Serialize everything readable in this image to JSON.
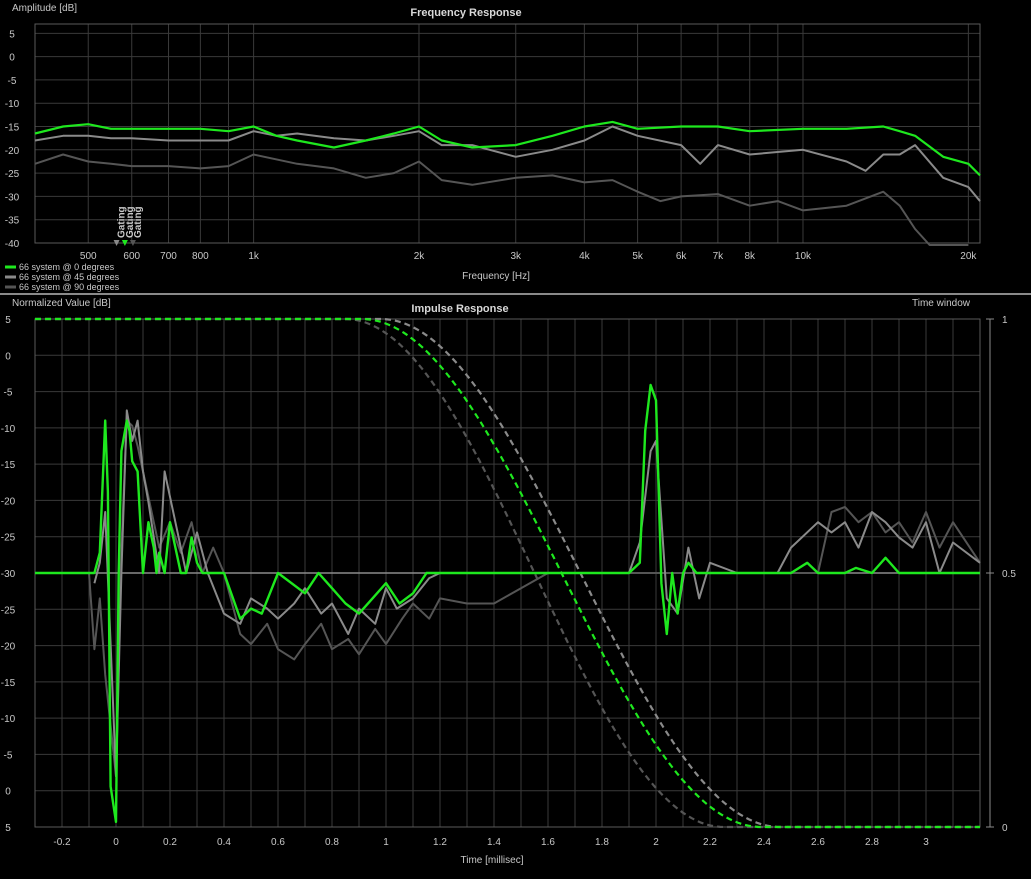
{
  "colors": {
    "green": "#1ee81e",
    "gray1": "#8a8a8a",
    "gray2": "#555555",
    "grid": "#3a3a3a",
    "separator": "#8a8a8a"
  },
  "chart_data": [
    {
      "type": "line",
      "title": "Frequency Response",
      "ylabel": "Amplitude [dB]",
      "xlabel": "Frequency [Hz]",
      "x_scale": "log",
      "xlim": [
        400,
        21000
      ],
      "ylim": [
        -40,
        7
      ],
      "grid": true,
      "y_ticks": [
        5,
        0,
        -5,
        -10,
        -15,
        -20,
        -25,
        -30,
        -35,
        -40
      ],
      "y_tick_labels": [
        "5",
        "0",
        "-5",
        "-10",
        "-15",
        "-20",
        "-25",
        "-30",
        "-35",
        "-40"
      ],
      "x_ticks": [
        500,
        600,
        700,
        800,
        1000,
        2000,
        3000,
        4000,
        5000,
        6000,
        7000,
        8000,
        10000,
        20000
      ],
      "x_tick_labels": [
        "500",
        "600",
        "700",
        "800",
        "1k",
        "2k",
        "3k",
        "4k",
        "5k",
        "6k",
        "7k",
        "8k",
        "10k",
        "20k"
      ],
      "gating_markers": [
        {
          "label": "Gating",
          "x": 563,
          "color": "#8a8a8a"
        },
        {
          "label": "Gating",
          "x": 583,
          "color": "#1ee81e"
        },
        {
          "label": "Gating",
          "x": 603,
          "color": "#555555"
        }
      ],
      "legend_position": "bottom-left",
      "series": [
        {
          "name": "66 system @ 0 degrees",
          "color": "#1ee81e",
          "x": [
            400,
            450,
            500,
            550,
            600,
            700,
            800,
            900,
            1000,
            1100,
            1200,
            1400,
            1600,
            1800,
            2000,
            2200,
            2500,
            3000,
            3500,
            4000,
            4500,
            5000,
            6000,
            7000,
            8000,
            10000,
            12000,
            14000,
            15000,
            16000,
            18000,
            20000,
            21000
          ],
          "y": [
            -16.5,
            -15,
            -14.5,
            -15.5,
            -15.5,
            -15.5,
            -15.5,
            -16,
            -15,
            -17,
            -18,
            -19.5,
            -18,
            -16.5,
            -15,
            -18,
            -19.5,
            -19,
            -17,
            -15,
            -14,
            -15.5,
            -15,
            -15,
            -16,
            -15.5,
            -15.5,
            -15,
            -16,
            -17,
            -21.5,
            -23,
            -25.5
          ]
        },
        {
          "name": "66 system @ 45 degrees",
          "color": "#8a8a8a",
          "x": [
            400,
            450,
            500,
            550,
            600,
            700,
            800,
            900,
            1000,
            1100,
            1200,
            1400,
            1600,
            1800,
            2000,
            2200,
            2500,
            3000,
            3500,
            4000,
            4500,
            5000,
            6000,
            6500,
            7000,
            8000,
            10000,
            12000,
            13000,
            14000,
            15000,
            16000,
            18000,
            20000,
            21000
          ],
          "y": [
            -18,
            -17,
            -17,
            -17.5,
            -17.5,
            -18,
            -18,
            -18,
            -16,
            -17,
            -16.5,
            -17.5,
            -18,
            -17,
            -16,
            -19,
            -19,
            -21.5,
            -20,
            -18,
            -15,
            -17,
            -19,
            -23,
            -19,
            -21,
            -20,
            -22.5,
            -24.5,
            -21,
            -21,
            -19,
            -26,
            -28,
            -31
          ]
        },
        {
          "name": "66 system @ 90 degrees",
          "color": "#555555",
          "x": [
            400,
            450,
            500,
            550,
            600,
            700,
            800,
            900,
            1000,
            1200,
            1400,
            1600,
            1800,
            2000,
            2200,
            2500,
            3000,
            3500,
            4000,
            4500,
            5000,
            5500,
            6000,
            7000,
            8000,
            9000,
            10000,
            12000,
            14000,
            15000,
            16000,
            17000,
            18000,
            20000
          ],
          "y": [
            -23,
            -21,
            -22.5,
            -23,
            -23.5,
            -23.5,
            -24,
            -23.5,
            -21,
            -23,
            -24,
            -26,
            -25,
            -22.5,
            -26.5,
            -27.5,
            -26,
            -25.5,
            -27,
            -26.5,
            -29,
            -31,
            -30,
            -29.5,
            -32,
            -31,
            -33,
            -32,
            -29,
            -32,
            -37,
            -40.5,
            -41,
            -41
          ]
        }
      ]
    },
    {
      "type": "line",
      "title": "Impulse Response",
      "ylabel": "Normalized Value [dB]",
      "y2label": "Time window",
      "xlabel": "Time [millisec]",
      "xlim": [
        -0.3,
        3.2
      ],
      "ylim": [
        0,
        1
      ],
      "grid": true,
      "y_tick_labels": [
        "5",
        "0",
        "-5",
        "-10",
        "-15",
        "-20",
        "-25",
        "-30",
        "-25",
        "-20",
        "-15",
        "-10",
        "-5",
        "0",
        "5"
      ],
      "y2_ticks": [
        1,
        0.5,
        0
      ],
      "y2_tick_labels": [
        "1",
        "0.5",
        "0"
      ],
      "x_ticks": [
        -0.2,
        0,
        0.2,
        0.4,
        0.6,
        0.8,
        1,
        1.2,
        1.4,
        1.6,
        1.8,
        2,
        2.2,
        2.4,
        2.6,
        2.8,
        3
      ],
      "x_tick_labels": [
        "-0.2",
        "0",
        "0.2",
        "0.4",
        "0.6",
        "0.8",
        "1",
        "1.2",
        "1.4",
        "1.6",
        "1.8",
        "2",
        "2.2",
        "2.4",
        "2.6",
        "2.8",
        "3"
      ],
      "series": [
        {
          "name": "66 system @ 0 degrees",
          "color": "#1ee81e",
          "x": [
            -0.3,
            -0.08,
            -0.06,
            -0.04,
            -0.03,
            -0.02,
            0,
            0.01,
            0.02,
            0.04,
            0.05,
            0.06,
            0.08,
            0.1,
            0.12,
            0.14,
            0.15,
            0.16,
            0.18,
            0.2,
            0.22,
            0.24,
            0.26,
            0.28,
            0.3,
            0.32,
            0.4,
            0.46,
            0.5,
            0.54,
            0.6,
            0.7,
            0.75,
            0.8,
            0.85,
            0.9,
            0.95,
            1.0,
            1.05,
            1.1,
            1.15,
            1.2,
            1.9,
            1.94,
            1.96,
            1.98,
            2.0,
            2.02,
            2.04,
            2.06,
            2.08,
            2.1,
            2.12,
            2.15,
            2.2,
            2.5,
            2.56,
            2.6,
            2.7,
            2.74,
            2.8,
            2.85,
            2.9,
            2.95,
            3.0,
            3.2
          ],
          "y": [
            0.5,
            0.5,
            0.54,
            0.8,
            0.66,
            0.08,
            0.01,
            0.5,
            0.74,
            0.8,
            0.78,
            0.72,
            0.7,
            0.5,
            0.6,
            0.55,
            0.5,
            0.54,
            0.5,
            0.6,
            0.55,
            0.5,
            0.5,
            0.57,
            0.52,
            0.5,
            0.5,
            0.41,
            0.43,
            0.42,
            0.5,
            0.46,
            0.5,
            0.47,
            0.44,
            0.42,
            0.45,
            0.48,
            0.44,
            0.46,
            0.5,
            0.5,
            0.5,
            0.52,
            0.78,
            0.87,
            0.84,
            0.48,
            0.38,
            0.5,
            0.42,
            0.5,
            0.52,
            0.5,
            0.5,
            0.5,
            0.52,
            0.5,
            0.5,
            0.51,
            0.5,
            0.53,
            0.5,
            0.5,
            0.5,
            0.5
          ]
        },
        {
          "name": "66 system @ 45 degrees",
          "color": "#8a8a8a",
          "x": [
            -0.08,
            -0.06,
            -0.04,
            -0.02,
            0,
            0.02,
            0.04,
            0.06,
            0.08,
            0.1,
            0.12,
            0.14,
            0.16,
            0.18,
            0.2,
            0.22,
            0.24,
            0.26,
            0.3,
            0.34,
            0.4,
            0.46,
            0.5,
            0.56,
            0.6,
            0.66,
            0.7,
            0.76,
            0.8,
            0.86,
            0.9,
            0.96,
            1.0,
            1.04,
            1.1,
            1.16,
            1.2,
            1.9,
            1.94,
            1.98,
            2.0,
            2.04,
            2.08,
            2.12,
            2.16,
            2.2,
            2.3,
            2.35,
            2.4,
            2.45,
            2.5,
            2.6,
            2.65,
            2.7,
            2.75,
            2.8,
            2.85,
            2.9,
            2.95,
            3.0,
            3.05,
            3.1,
            3.2
          ],
          "y": [
            0.48,
            0.52,
            0.62,
            0.36,
            0.1,
            0.5,
            0.82,
            0.76,
            0.8,
            0.7,
            0.64,
            0.57,
            0.5,
            0.7,
            0.65,
            0.6,
            0.55,
            0.5,
            0.58,
            0.5,
            0.42,
            0.4,
            0.45,
            0.43,
            0.41,
            0.44,
            0.47,
            0.42,
            0.44,
            0.38,
            0.43,
            0.4,
            0.47,
            0.43,
            0.45,
            0.49,
            0.5,
            0.5,
            0.56,
            0.74,
            0.76,
            0.45,
            0.42,
            0.55,
            0.45,
            0.52,
            0.5,
            0.5,
            0.5,
            0.5,
            0.55,
            0.6,
            0.58,
            0.6,
            0.55,
            0.62,
            0.6,
            0.57,
            0.55,
            0.6,
            0.5,
            0.56,
            0.52
          ]
        },
        {
          "name": "66 system @ 90 degrees",
          "color": "#555555",
          "x": [
            -0.1,
            -0.08,
            -0.06,
            -0.04,
            -0.02,
            0,
            0.02,
            0.04,
            0.06,
            0.08,
            0.1,
            0.12,
            0.14,
            0.16,
            0.2,
            0.24,
            0.28,
            0.32,
            0.36,
            0.4,
            0.46,
            0.5,
            0.56,
            0.6,
            0.66,
            0.7,
            0.76,
            0.8,
            0.86,
            0.9,
            0.96,
            1.0,
            1.06,
            1.1,
            1.16,
            1.2,
            1.3,
            1.4,
            1.5,
            1.6,
            2.6,
            2.65,
            2.7,
            2.75,
            2.8,
            2.85,
            2.9,
            2.95,
            3.0,
            3.05,
            3.1,
            3.2
          ],
          "y": [
            0.5,
            0.35,
            0.45,
            0.3,
            0.2,
            0.1,
            0.55,
            0.8,
            0.79,
            0.75,
            0.7,
            0.65,
            0.6,
            0.55,
            0.6,
            0.54,
            0.6,
            0.5,
            0.55,
            0.5,
            0.38,
            0.36,
            0.4,
            0.35,
            0.33,
            0.36,
            0.4,
            0.35,
            0.37,
            0.34,
            0.39,
            0.36,
            0.41,
            0.44,
            0.41,
            0.45,
            0.44,
            0.44,
            0.47,
            0.5,
            0.5,
            0.62,
            0.63,
            0.6,
            0.62,
            0.58,
            0.6,
            0.56,
            0.62,
            0.55,
            0.6,
            0.52
          ]
        }
      ],
      "time_window_series": [
        {
          "name": "66 system @ 0 degrees",
          "color": "#1ee81e",
          "center_ms": 1.65,
          "half_width_ms": 0.74,
          "y": 0.5
        },
        {
          "name": "66 system @ 45 degrees",
          "color": "#8a8a8a",
          "center_ms": 1.72,
          "half_width_ms": 0.74,
          "y": 0.5
        },
        {
          "name": "66 system @ 90 degrees",
          "color": "#555555",
          "center_ms": 1.55,
          "half_width_ms": 0.7,
          "y": 0.5
        }
      ]
    }
  ]
}
